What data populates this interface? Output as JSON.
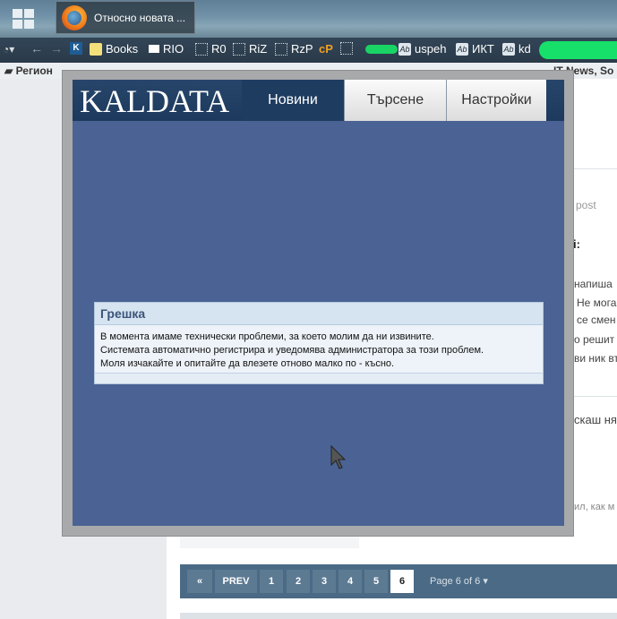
{
  "taskbar": {
    "window_title": "Относно новата ..."
  },
  "bookmarks": {
    "items": [
      {
        "label": "Books",
        "icon": "folder-icon"
      },
      {
        "label": "RIO",
        "icon": "note-icon"
      },
      {
        "label": "R0",
        "icon": "dotted-page-icon"
      },
      {
        "label": "RiZ",
        "icon": "dotted-page-icon"
      },
      {
        "label": "RzP",
        "icon": "dotted-page-icon"
      },
      {
        "label": "cP",
        "icon": "cp-icon"
      },
      {
        "label": "uspeh",
        "icon": "ab-icon"
      },
      {
        "label": "ИКТ",
        "icon": "ab-icon"
      },
      {
        "label": "kd",
        "icon": "ab-icon"
      }
    ],
    "second_row": {
      "left_label": "Регион",
      "right_label": "IT News, So"
    }
  },
  "site": {
    "logo_text": "KALDATA",
    "tabs": [
      "Новини",
      "Търсене",
      "Настройки"
    ]
  },
  "error": {
    "title": "Грешка",
    "lines": [
      "В момента имаме технически проблеми, за което молим да ни извините.",
      "Системата автоматично регистрира и уведомява администратора за този проблем.",
      "Моля изчакайте и опитайте да влезете отново малко по - късно."
    ]
  },
  "background_page": {
    "peek_texts": [
      "post",
      "i:",
      "напиша",
      "Не мога",
      "се смен",
      "о решит",
      "ви ник вт",
      "скаш ня",
      "ил, как м"
    ],
    "pager": {
      "first_label": "«",
      "prev_label": "PREV",
      "pages": [
        "1",
        "2",
        "3",
        "4",
        "5",
        "6"
      ],
      "current_page": "6",
      "page_info": "Page 6 of 6 ▾"
    }
  },
  "colors": {
    "popup_bg": "#4a6394",
    "header_bg": "#1d3a5e",
    "error_title": "#3b5478",
    "pager_bg": "#4a6a85"
  }
}
